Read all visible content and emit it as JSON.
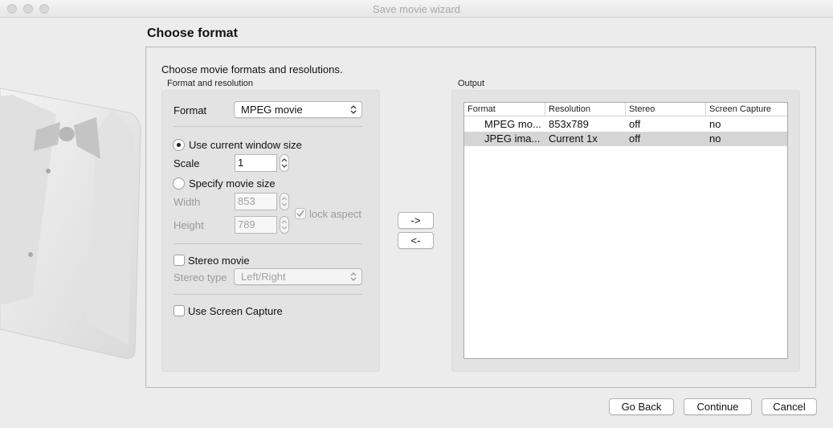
{
  "window": {
    "title": "Save movie wizard"
  },
  "page": {
    "title": "Choose format",
    "intro": "Choose movie formats and resolutions."
  },
  "format_group": {
    "title": "Format and resolution",
    "format_label": "Format",
    "format_value": "MPEG movie",
    "use_current_label": "Use current window size",
    "use_current_selected": true,
    "scale_label": "Scale",
    "scale_value": "1",
    "specify_label": "Specify movie size",
    "width_label": "Width",
    "width_value": "853",
    "height_label": "Height",
    "height_value": "789",
    "lock_aspect_label": "lock aspect",
    "stereo_movie_label": "Stereo movie",
    "stereo_type_label": "Stereo type",
    "stereo_type_value": "Left/Right",
    "screen_capture_label": "Use Screen Capture"
  },
  "transfer": {
    "add_label": "->",
    "remove_label": "<-"
  },
  "output": {
    "title": "Output",
    "columns": [
      "Format",
      "Resolution",
      "Stereo",
      "Screen Capture"
    ],
    "rows": [
      {
        "format": "MPEG mo...",
        "resolution": "853x789",
        "stereo": "off",
        "capture": "no"
      },
      {
        "format": "JPEG ima...",
        "resolution": "Current 1x",
        "stereo": "off",
        "capture": "no"
      }
    ]
  },
  "footer": {
    "back_label": "Go Back",
    "continue_label": "Continue",
    "cancel_label": "Cancel"
  }
}
